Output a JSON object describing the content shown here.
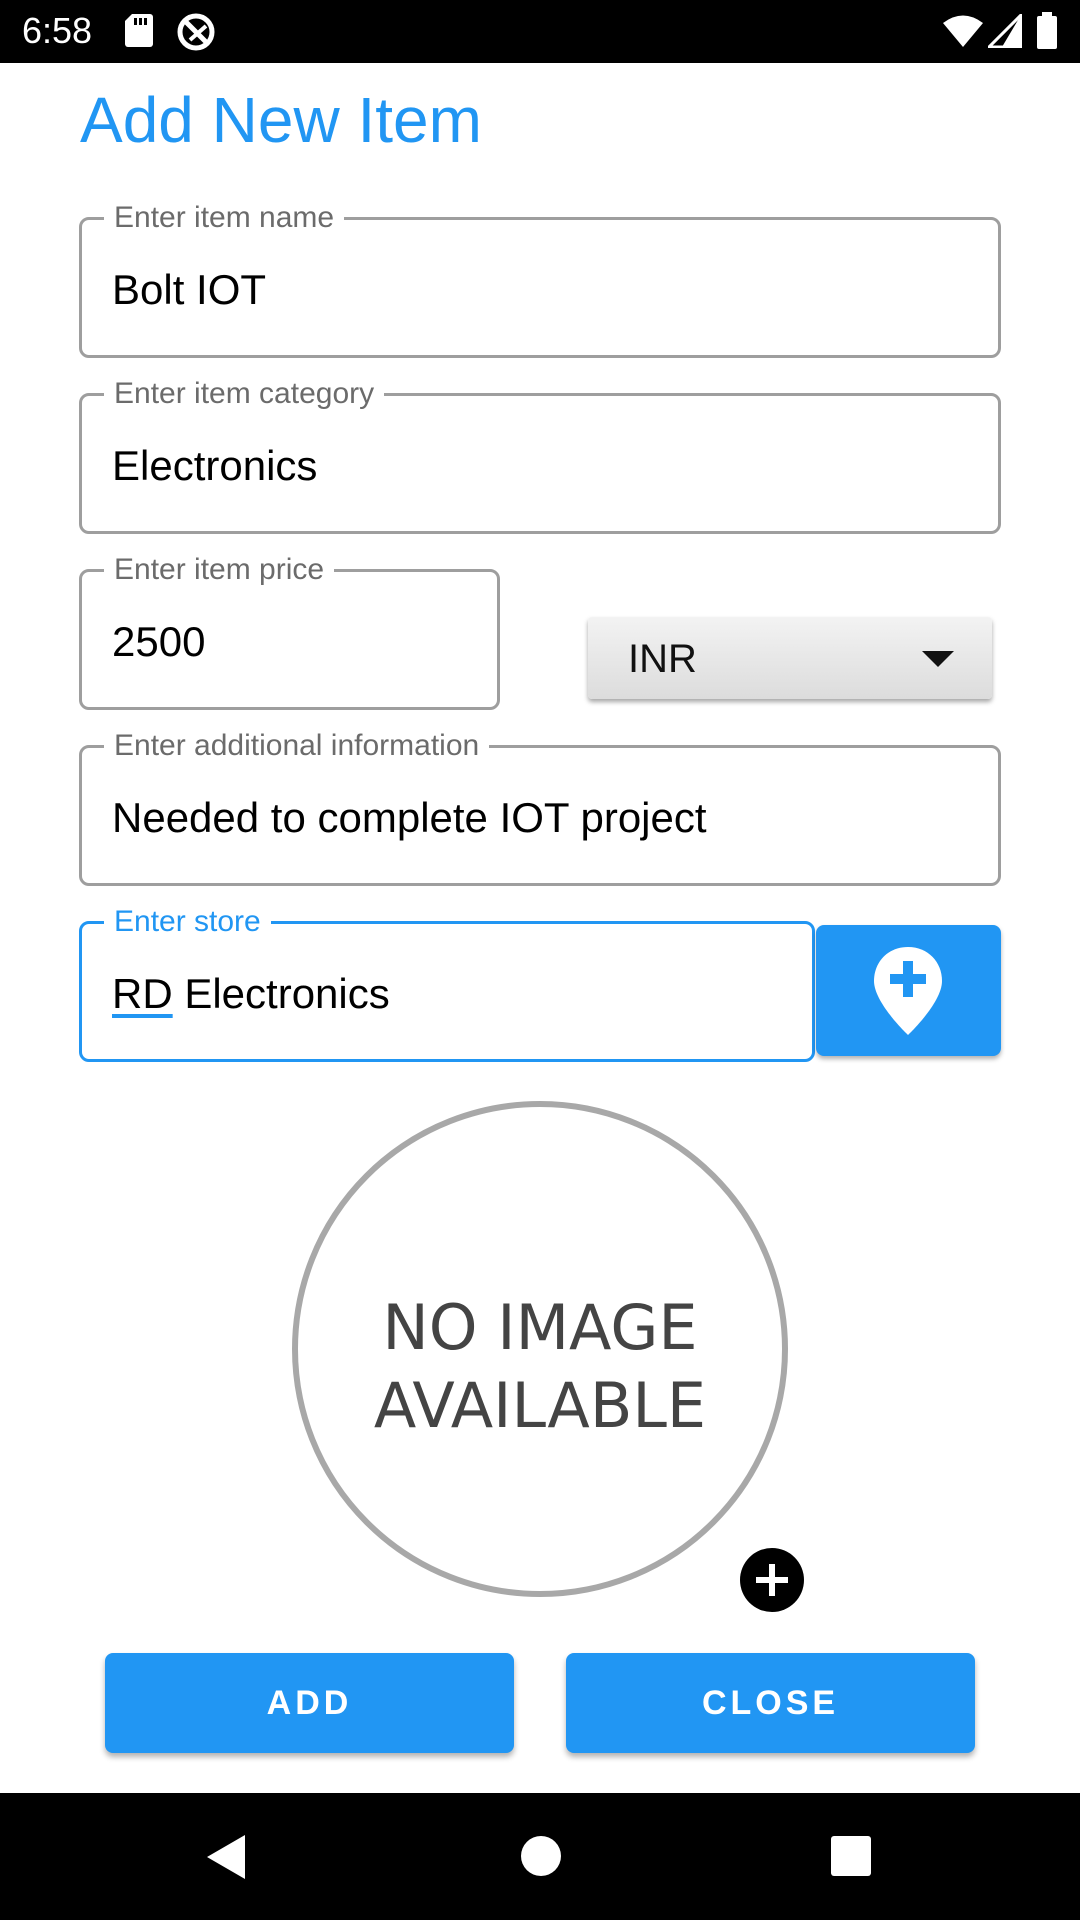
{
  "status_bar": {
    "time": "6:58",
    "icons": [
      "sd-card-icon",
      "sync-disabled-icon",
      "wifi-icon",
      "cell-signal-icon",
      "battery-icon"
    ]
  },
  "page": {
    "title": "Add New Item"
  },
  "form": {
    "item_name": {
      "label": "Enter item name",
      "value": "Bolt IOT"
    },
    "item_category": {
      "label": "Enter item category",
      "value": "Electronics"
    },
    "item_price": {
      "label": "Enter item price",
      "value": "2500"
    },
    "currency": {
      "selected": "INR"
    },
    "additional_info": {
      "label": "Enter additional information",
      "value": "Needed to complete IOT project"
    },
    "store": {
      "label": "Enter store",
      "value_underlined": "RD",
      "value_rest": " Electronics"
    }
  },
  "image": {
    "placeholder": "NO IMAGE\nAVAILABLE"
  },
  "actions": {
    "add_label": "ADD",
    "close_label": "CLOSE"
  },
  "colors": {
    "accent": "#2196F3",
    "outline": "#9e9e9e",
    "bars": "#000000"
  }
}
